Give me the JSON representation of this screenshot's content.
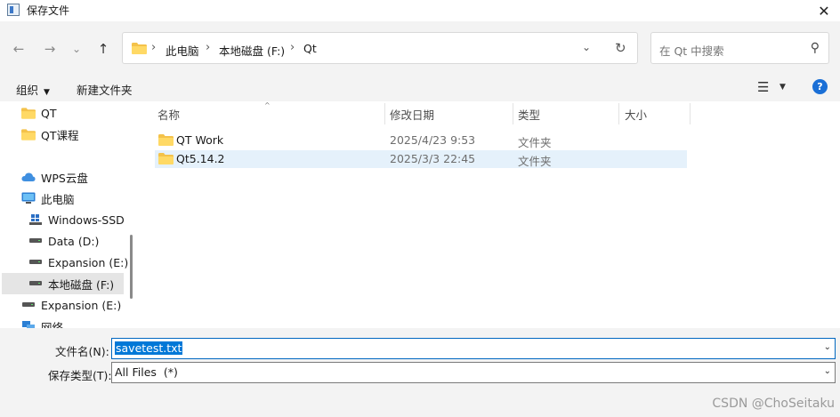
{
  "window": {
    "title": "保存文件",
    "close_glyph": "✕"
  },
  "nav": {
    "back_glyph": "←",
    "forward_glyph": "→",
    "recent_glyph": "⌄",
    "up_glyph": "↑",
    "breadcrumb": [
      "此电脑",
      "本地磁盘 (F:)",
      "Qt"
    ],
    "breadcrumb_sep": "›",
    "dropdown_glyph": "⌄",
    "refresh_glyph": "↻",
    "search_placeholder": "在 Qt 中搜索",
    "search_icon_glyph": "⚲"
  },
  "commandbar": {
    "organize_label": "组织",
    "organize_caret": "▼",
    "new_folder_label": "新建文件夹",
    "view_glyph": "☰",
    "view_caret": "▼",
    "help_glyph": "?"
  },
  "sidebar": {
    "items": [
      {
        "label": "QT",
        "icon": "folder-icon"
      },
      {
        "label": "QT课程",
        "icon": "folder-icon"
      },
      {
        "label": "WPS云盘",
        "icon": "cloud-icon"
      },
      {
        "label": "此电脑",
        "icon": "monitor-icon"
      },
      {
        "label": "Windows-SSD",
        "icon": "windows-drive-icon"
      },
      {
        "label": "Data (D:)",
        "icon": "drive-icon"
      },
      {
        "label": "Expansion (E:)",
        "icon": "drive-icon"
      },
      {
        "label": "本地磁盘 (F:)",
        "icon": "drive-icon",
        "selected": true
      },
      {
        "label": "Expansion (E:)",
        "icon": "drive-icon"
      },
      {
        "label": "网络",
        "icon": "network-icon"
      }
    ]
  },
  "filelist": {
    "columns": [
      "名称",
      "修改日期",
      "类型",
      "大小"
    ],
    "sort_glyph": "^",
    "rows": [
      {
        "name": "QT Work",
        "date": "2025/4/23 9:53",
        "type": "文件夹",
        "size": ""
      },
      {
        "name": "Qt5.14.2",
        "date": "2025/3/3 22:45",
        "type": "文件夹",
        "size": "",
        "selected": true
      }
    ]
  },
  "form": {
    "filename_label": "文件名(N):",
    "filename_value": "savetest.txt",
    "filetype_label": "保存类型(T):",
    "filetype_value": "All Files  (*)",
    "dropdown_glyph": "⌄"
  },
  "watermark": "CSDN @ChoSeitaku",
  "colors": {
    "folder": "#f4c24a",
    "selection": "#e5f1fb",
    "accent": "#0078d7"
  }
}
